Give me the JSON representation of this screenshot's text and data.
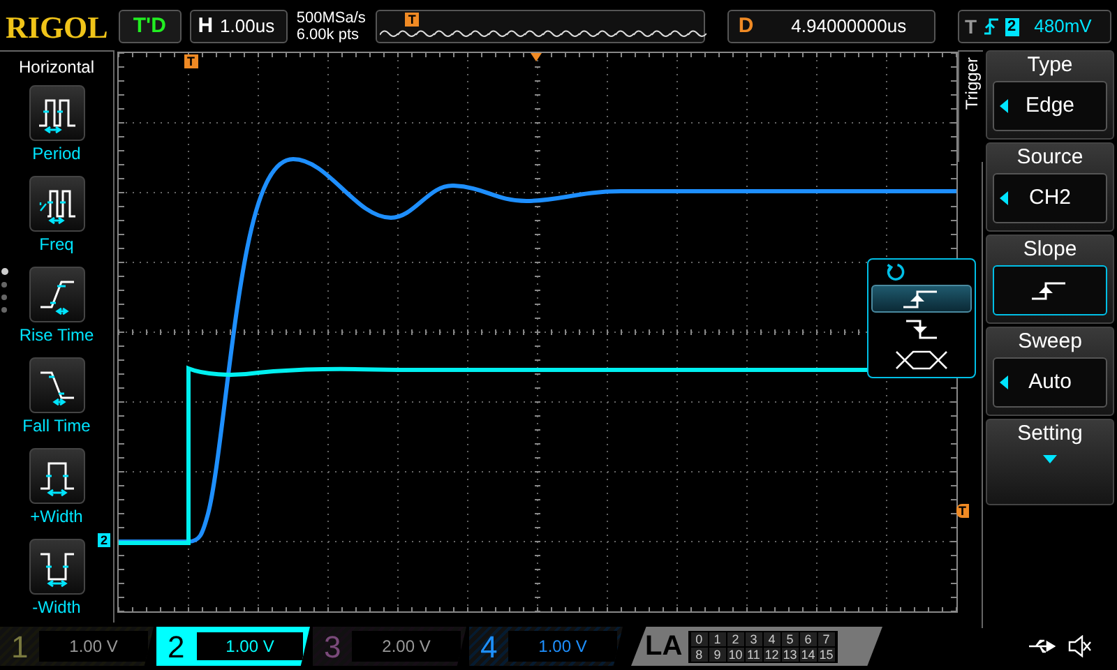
{
  "top_bar": {
    "logo": "RIGOL",
    "run_status": "T'D",
    "horizontal": {
      "label": "H",
      "value": "1.00us"
    },
    "sample_rate": "500MSa/s",
    "memory_depth": "6.00k pts",
    "memory_marker": "T",
    "delay": {
      "label": "D",
      "value": "4.94000000us"
    },
    "trigger": {
      "label": "T",
      "source": "2",
      "level": "480mV"
    }
  },
  "left_panel": {
    "title": "Horizontal",
    "pages": [
      {
        "selected": true
      },
      {
        "selected": false
      },
      {
        "selected": false
      },
      {
        "selected": false
      }
    ],
    "items": [
      {
        "kind": "period",
        "label": "Period"
      },
      {
        "kind": "freq",
        "label": "Freq"
      },
      {
        "kind": "rise",
        "label": "Rise Time"
      },
      {
        "kind": "fall",
        "label": "Fall Time"
      },
      {
        "kind": "pwidth",
        "label": "+Width"
      },
      {
        "kind": "nwidth",
        "label": "-Width"
      }
    ]
  },
  "plot": {
    "channel_marker": "2",
    "trigger_position_marker": "T",
    "trigger_level_marker": "T"
  },
  "right_panel": {
    "tab": "Trigger",
    "menu": [
      {
        "kind": "value",
        "title": "Type",
        "value": "Edge"
      },
      {
        "kind": "value",
        "title": "Source",
        "value": "CH2"
      },
      {
        "kind": "slope",
        "title": "Slope",
        "highlighted": true
      },
      {
        "kind": "value",
        "title": "Sweep",
        "value": "Auto"
      },
      {
        "kind": "more",
        "title": "Setting"
      }
    ]
  },
  "slope_popup": {
    "options": [
      {
        "kind": "rising",
        "selected": true
      },
      {
        "kind": "falling",
        "selected": false
      },
      {
        "kind": "either",
        "selected": false
      }
    ]
  },
  "bottom_bar": {
    "channels": [
      {
        "number": "1",
        "scale": "1.00 V",
        "on": false,
        "selected": false,
        "color": "#7a7a40"
      },
      {
        "number": "2",
        "scale": "1.00 V",
        "on": true,
        "selected": true,
        "color": "#00ffff"
      },
      {
        "number": "3",
        "scale": "2.00 V",
        "on": false,
        "selected": false,
        "color": "#7a4a7a"
      },
      {
        "number": "4",
        "scale": "1.00 V",
        "on": true,
        "selected": false,
        "color": "#1e90ff"
      }
    ],
    "la": {
      "label": "LA",
      "bits": [
        "0",
        "1",
        "2",
        "3",
        "4",
        "5",
        "6",
        "7",
        "8",
        "9",
        "10",
        "11",
        "12",
        "13",
        "14",
        "15"
      ]
    }
  }
}
